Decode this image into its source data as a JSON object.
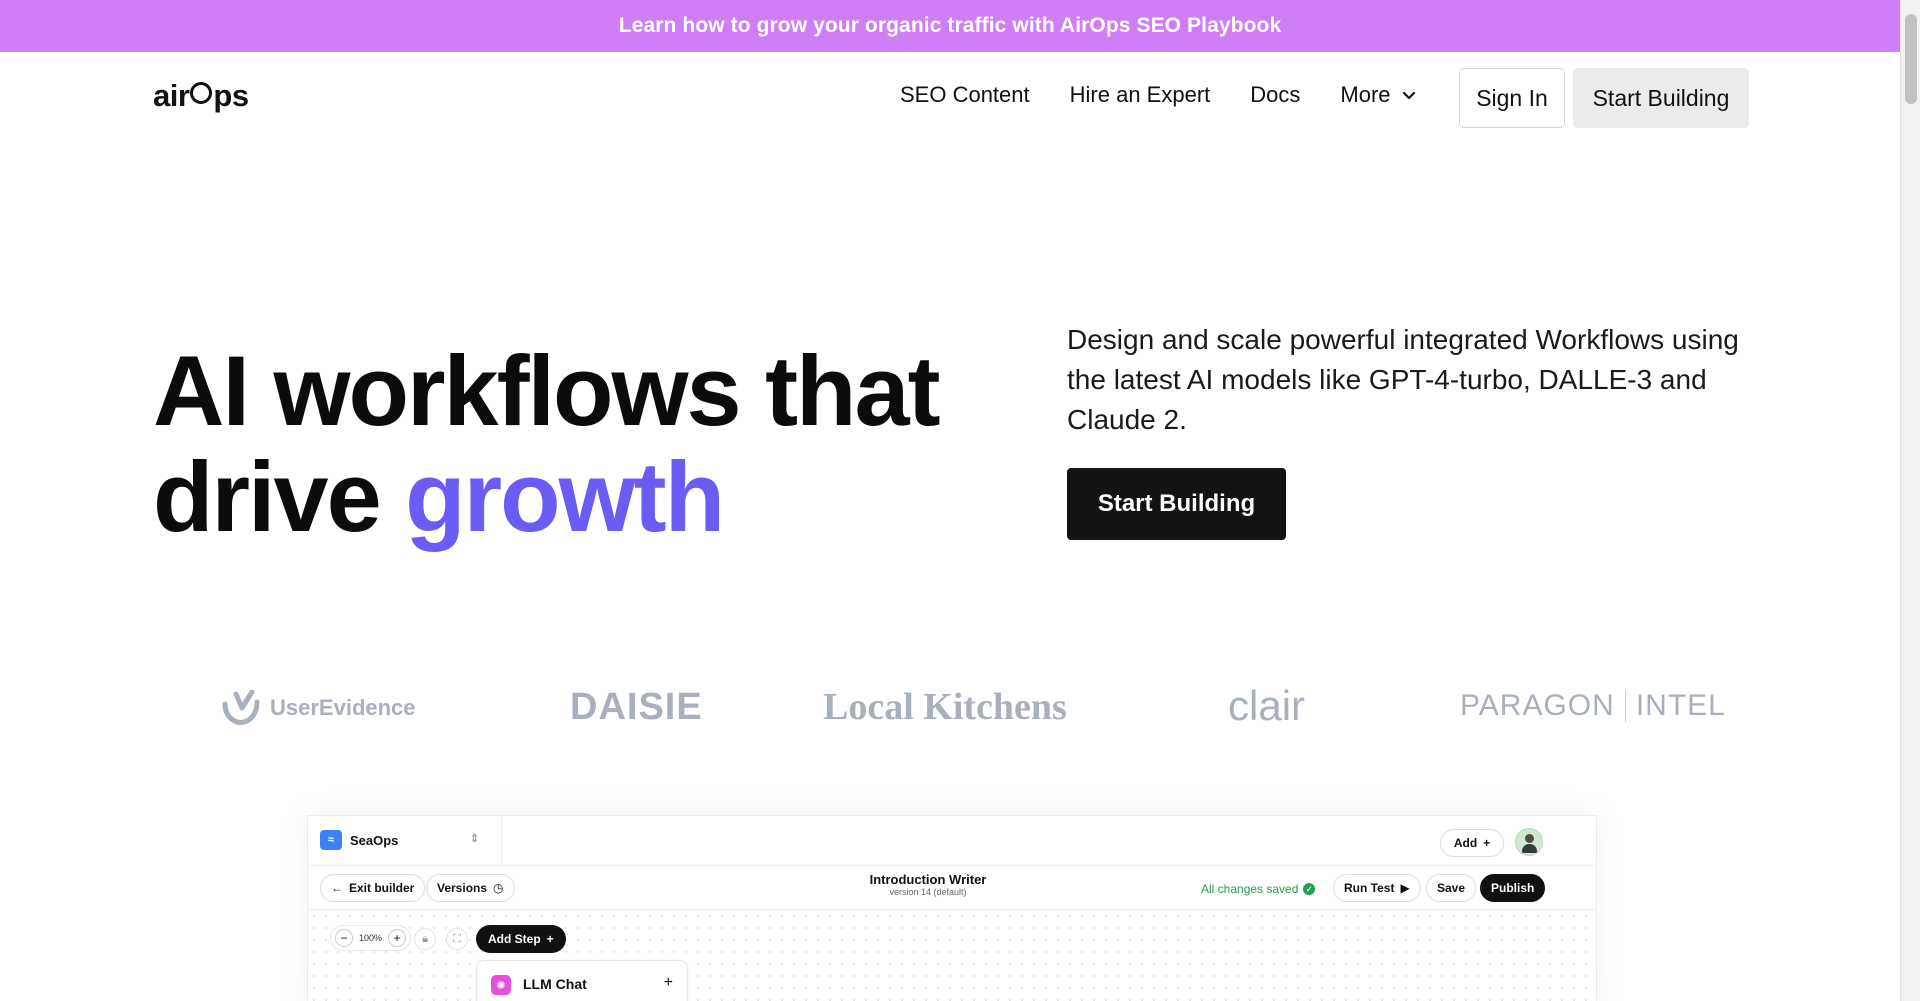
{
  "promo": {
    "text": "Learn how to grow your organic traffic with AirOps SEO Playbook"
  },
  "nav": {
    "logo": {
      "part1": "air",
      "part2": "ps"
    },
    "links": [
      "SEO Content",
      "Hire an Expert",
      "Docs",
      "More"
    ],
    "sign_in": "Sign In",
    "start_building": "Start Building"
  },
  "hero": {
    "title_line1": "AI workflows that",
    "title_line2_plain": "drive",
    "title_line2_accent": "growth",
    "description": "Design and scale powerful integrated Workflows using the latest AI models like GPT-4-turbo, DALLE-3 and Claude 2.",
    "cta": "Start Building",
    "accent_color": "#6b5cf6"
  },
  "logos": {
    "userevidence": "UserEvidence",
    "daisie": "DAISIE",
    "local_kitchens": "Local Kitchens",
    "clair": "clair",
    "paragon": "PARAGON",
    "intel": "INTEL"
  },
  "builder": {
    "workspace": "SeaOps",
    "add": "Add",
    "exit_builder": "Exit builder",
    "versions": "Versions",
    "workflow_title": "Introduction Writer",
    "workflow_version": "version 14 (default)",
    "saved_status": "All changes saved",
    "run_test": "Run Test",
    "save": "Save",
    "publish": "Publish",
    "zoom_level": "100%",
    "add_step": "Add Step",
    "llm_chat": "LLM Chat"
  },
  "colors": {
    "promo_bg": "#cf7ef6",
    "accent": "#6b5cf6",
    "saved_green": "#22a04b"
  }
}
